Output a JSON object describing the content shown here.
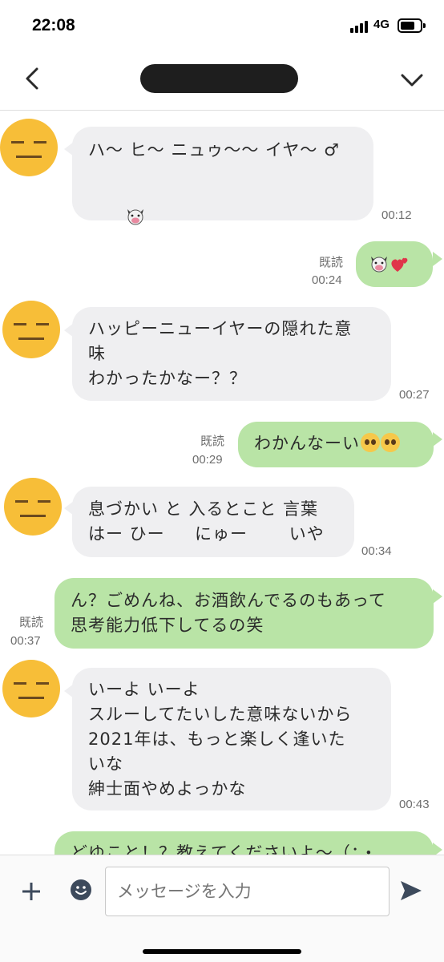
{
  "status": {
    "time": "22:08",
    "network": "4G"
  },
  "header": {
    "title": ""
  },
  "messages": [
    {
      "lines": [
        "ハ〜 ヒ〜 ニュゥ〜〜 イヤ〜 ♂"
      ],
      "time": "00:12"
    },
    {
      "read": "既読",
      "time": "00:24"
    },
    {
      "lines": [
        "ハッピーニューイヤーの隠れた意",
        "味",
        "わかったかなー？？"
      ],
      "time": "00:27"
    },
    {
      "text": "わかんなーい",
      "read": "既読",
      "time": "00:29"
    },
    {
      "lines": [
        "息づかい と 入るとこと 言葉",
        "はー ひー　  にゅー　　 いや"
      ],
      "time": "00:34"
    },
    {
      "lines": [
        "ん？ごめんね、お酒飲んでるのもあって",
        "思考能力低下してるの笑"
      ],
      "read": "既読",
      "time": "00:37"
    },
    {
      "lines": [
        "いーよ いーよ",
        "スルーしてたいした意味ないから",
        "2021年は、もっと楽しく逢いた",
        "いな",
        "紳士面やめよっかな"
      ],
      "time": "00:43"
    },
    {
      "lines": [
        "どゆこと！？教えてくださいよ〜（；・"
      ]
    }
  ],
  "input": {
    "placeholder": "メッセージを入力"
  },
  "icons": {
    "back": "chevron-left-icon",
    "dropdown": "chevron-down-icon",
    "plus": "plus-icon",
    "emoji": "smiley-icon",
    "send": "send-icon",
    "pig": "pig-face-icon",
    "hearts": "two-hearts-icon",
    "pleading": "pleading-face-icon"
  },
  "colors": {
    "incoming": "#efeff1",
    "outgoing": "#b9e4a6",
    "avatar": "#f7be38"
  }
}
